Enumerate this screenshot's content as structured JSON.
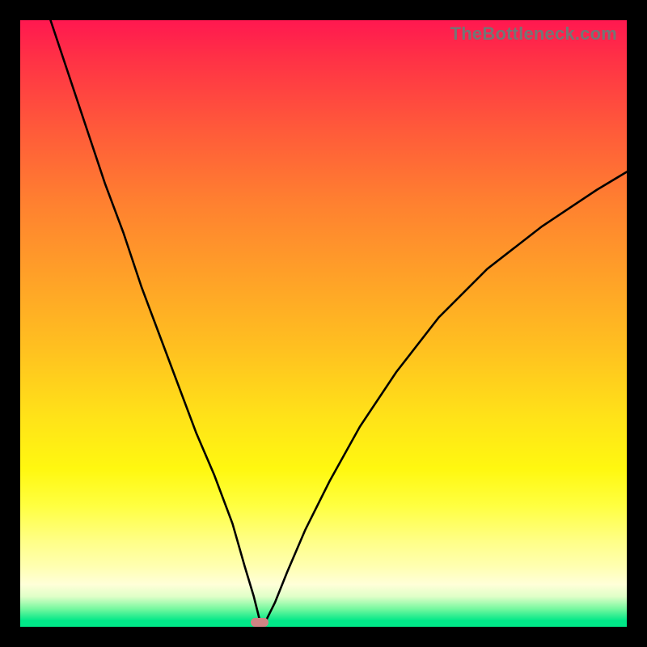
{
  "watermark": "TheBottleneck.com",
  "marker": {
    "x_ratio": 0.395,
    "y_ratio": 0.992
  },
  "chart_data": {
    "type": "line",
    "title": "",
    "xlabel": "",
    "ylabel": "",
    "xlim": [
      0,
      100
    ],
    "ylim": [
      0,
      100
    ],
    "series": [
      {
        "name": "curve-left",
        "x": [
          5,
          8,
          11,
          14,
          17,
          20,
          23,
          26,
          29,
          32,
          35,
          37,
          38.5,
          39.5
        ],
        "y": [
          100,
          91,
          82,
          73,
          65,
          56,
          48,
          40,
          32,
          25,
          17,
          10,
          5,
          1
        ]
      },
      {
        "name": "curve-right",
        "x": [
          40.5,
          42,
          44,
          47,
          51,
          56,
          62,
          69,
          77,
          86,
          95,
          100
        ],
        "y": [
          1,
          4,
          9,
          16,
          24,
          33,
          42,
          51,
          59,
          66,
          72,
          75
        ]
      }
    ],
    "annotations": [
      {
        "name": "min-marker",
        "x": 39.5,
        "y": 0.8
      }
    ]
  }
}
